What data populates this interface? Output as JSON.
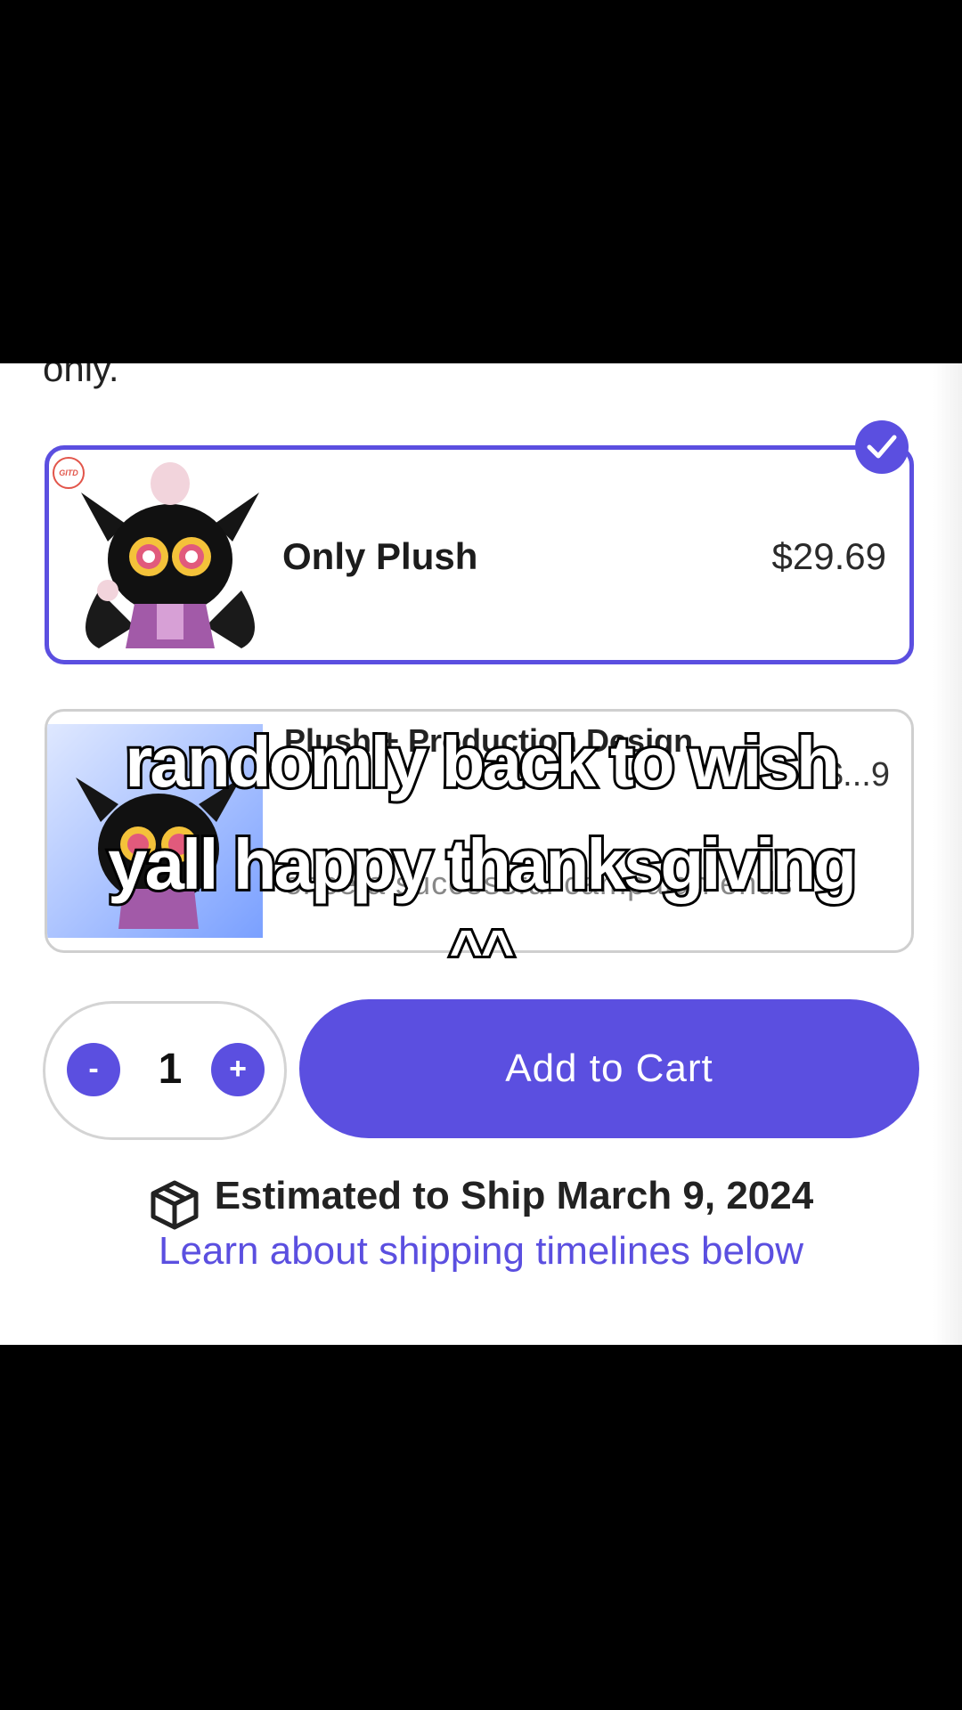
{
  "intro_text": "only.",
  "options": [
    {
      "title": "Only Plush",
      "price": "$29.69",
      "selected": true,
      "badge": "GITD"
    },
    {
      "title": "Plush + Production Design",
      "price": "$...9",
      "subtitle": "once a successful campaign ends",
      "selected": false
    }
  ],
  "quantity": {
    "minus_label": "-",
    "value": "1",
    "plus_label": "+"
  },
  "add_to_cart_label": "Add to Cart",
  "shipping": {
    "estimate": "Estimated to Ship March 9, 2024",
    "link": "Learn about shipping timelines below"
  },
  "caption": {
    "line1": "randomly back to wish",
    "line2": "yall happy thanksgiving",
    "line3": "^^"
  },
  "colors": {
    "accent": "#5b4fe0",
    "background": "#000000",
    "panel": "#ffffff"
  },
  "icons": [
    "checkmark-icon",
    "package-box-icon"
  ]
}
